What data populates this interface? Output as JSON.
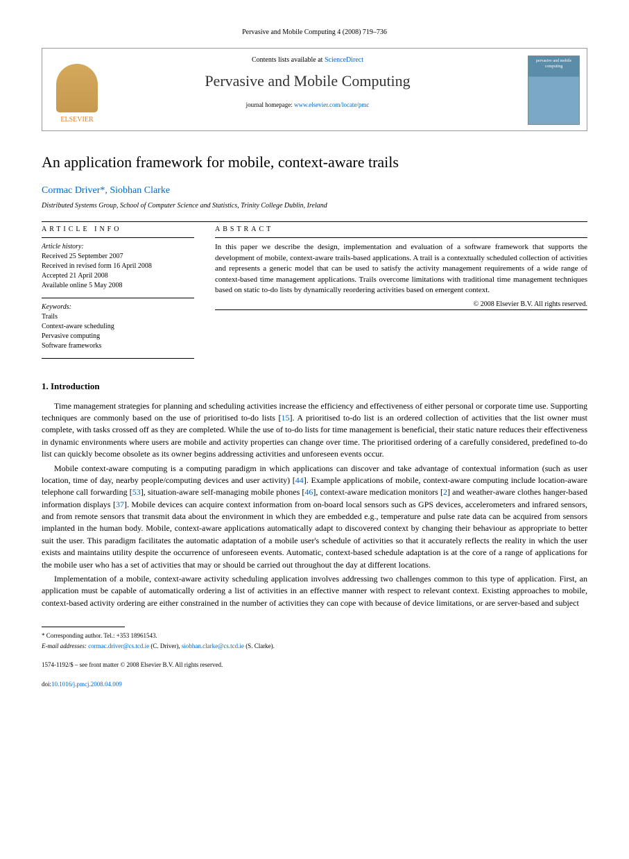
{
  "page_header": "Pervasive and Mobile Computing 4 (2008) 719–736",
  "box": {
    "contents_prefix": "Contents lists available at ",
    "contents_link": "ScienceDirect",
    "journal_name": "Pervasive and Mobile Computing",
    "homepage_prefix": "journal homepage: ",
    "homepage_link": "www.elsevier.com/locate/pmc",
    "elsevier_label": "ELSEVIER",
    "cover_text": "pervasive and mobile computing"
  },
  "title": "An application framework for mobile, context-aware trails",
  "authors": "Cormac Driver*, Siobhan Clarke",
  "affiliation": "Distributed Systems Group, School of Computer Science and Statistics, Trinity College Dublin, Ireland",
  "article_info": {
    "label": "ARTICLE INFO",
    "history_label": "Article history:",
    "history": [
      "Received 25 September 2007",
      "Received in revised form 16 April 2008",
      "Accepted 21 April 2008",
      "Available online 5 May 2008"
    ],
    "keywords_label": "Keywords:",
    "keywords": [
      "Trails",
      "Context-aware scheduling",
      "Pervasive computing",
      "Software frameworks"
    ]
  },
  "abstract": {
    "label": "ABSTRACT",
    "text": "In this paper we describe the design, implementation and evaluation of a software framework that supports the development of mobile, context-aware trails-based applications. A trail is a contextually scheduled collection of activities and represents a generic model that can be used to satisfy the activity management requirements of a wide range of context-based time management applications. Trails overcome limitations with traditional time management techniques based on static to-do lists by dynamically reordering activities based on emergent context.",
    "copyright": "© 2008 Elsevier B.V. All rights reserved."
  },
  "sections": {
    "intro_heading": "1. Introduction",
    "para1_a": "Time management strategies for planning and scheduling activities increase the efficiency and effectiveness of either personal or corporate time use. Supporting techniques are commonly based on the use of prioritised to-do lists [",
    "para1_ref1": "15",
    "para1_b": "]. A prioritised to-do list is an ordered collection of activities that the list owner must complete, with tasks crossed off as they are completed. While the use of to-do lists for time management is beneficial, their static nature reduces their effectiveness in dynamic environments where users are mobile and activity properties can change over time. The prioritised ordering of a carefully considered, predefined to-do list can quickly become obsolete as its owner begins addressing activities and unforeseen events occur.",
    "para2_a": "Mobile context-aware computing is a computing paradigm in which applications can discover and take advantage of contextual information (such as user location, time of day, nearby people/computing devices and user activity) [",
    "para2_ref1": "44",
    "para2_b": "]. Example applications of mobile, context-aware computing include location-aware telephone call forwarding [",
    "para2_ref2": "53",
    "para2_c": "], situation-aware self-managing mobile phones [",
    "para2_ref3": "46",
    "para2_d": "], context-aware medication monitors [",
    "para2_ref4": "2",
    "para2_e": "] and weather-aware clothes hanger-based information displays [",
    "para2_ref5": "37",
    "para2_f": "]. Mobile devices can acquire context information from on-board local sensors such as GPS devices, accelerometers and infrared sensors, and from remote sensors that transmit data about the environment in which they are embedded e.g., temperature and pulse rate data can be acquired from sensors implanted in the human body. Mobile, context-aware applications automatically adapt to discovered context by changing their behaviour as appropriate to better suit the user. This paradigm facilitates the automatic adaptation of a mobile user's schedule of activities so that it accurately reflects the reality in which the user exists and maintains utility despite the occurrence of unforeseen events. Automatic, context-based schedule adaptation is at the core of a range of applications for the mobile user who has a set of activities that may or should be carried out throughout the day at different locations.",
    "para3": "Implementation of a mobile, context-aware activity scheduling application involves addressing two challenges common to this type of application. First, an application must be capable of automatically ordering a list of activities in an effective manner with respect to relevant context. Existing approaches to mobile, context-based activity ordering are either constrained in the number of activities they can cope with because of device limitations, or are server-based and subject"
  },
  "footnotes": {
    "corr": "* Corresponding author. Tel.: +353 18961543.",
    "email_label": "E-mail addresses:",
    "email1": "cormac.driver@cs.tcd.ie",
    "email1_who": " (C. Driver), ",
    "email2": "siobhan.clarke@cs.tcd.ie",
    "email2_who": " (S. Clarke)."
  },
  "bottom": {
    "line1": "1574-1192/$ – see front matter © 2008 Elsevier B.V. All rights reserved.",
    "doi_label": "doi:",
    "doi": "10.1016/j.pmcj.2008.04.009"
  }
}
